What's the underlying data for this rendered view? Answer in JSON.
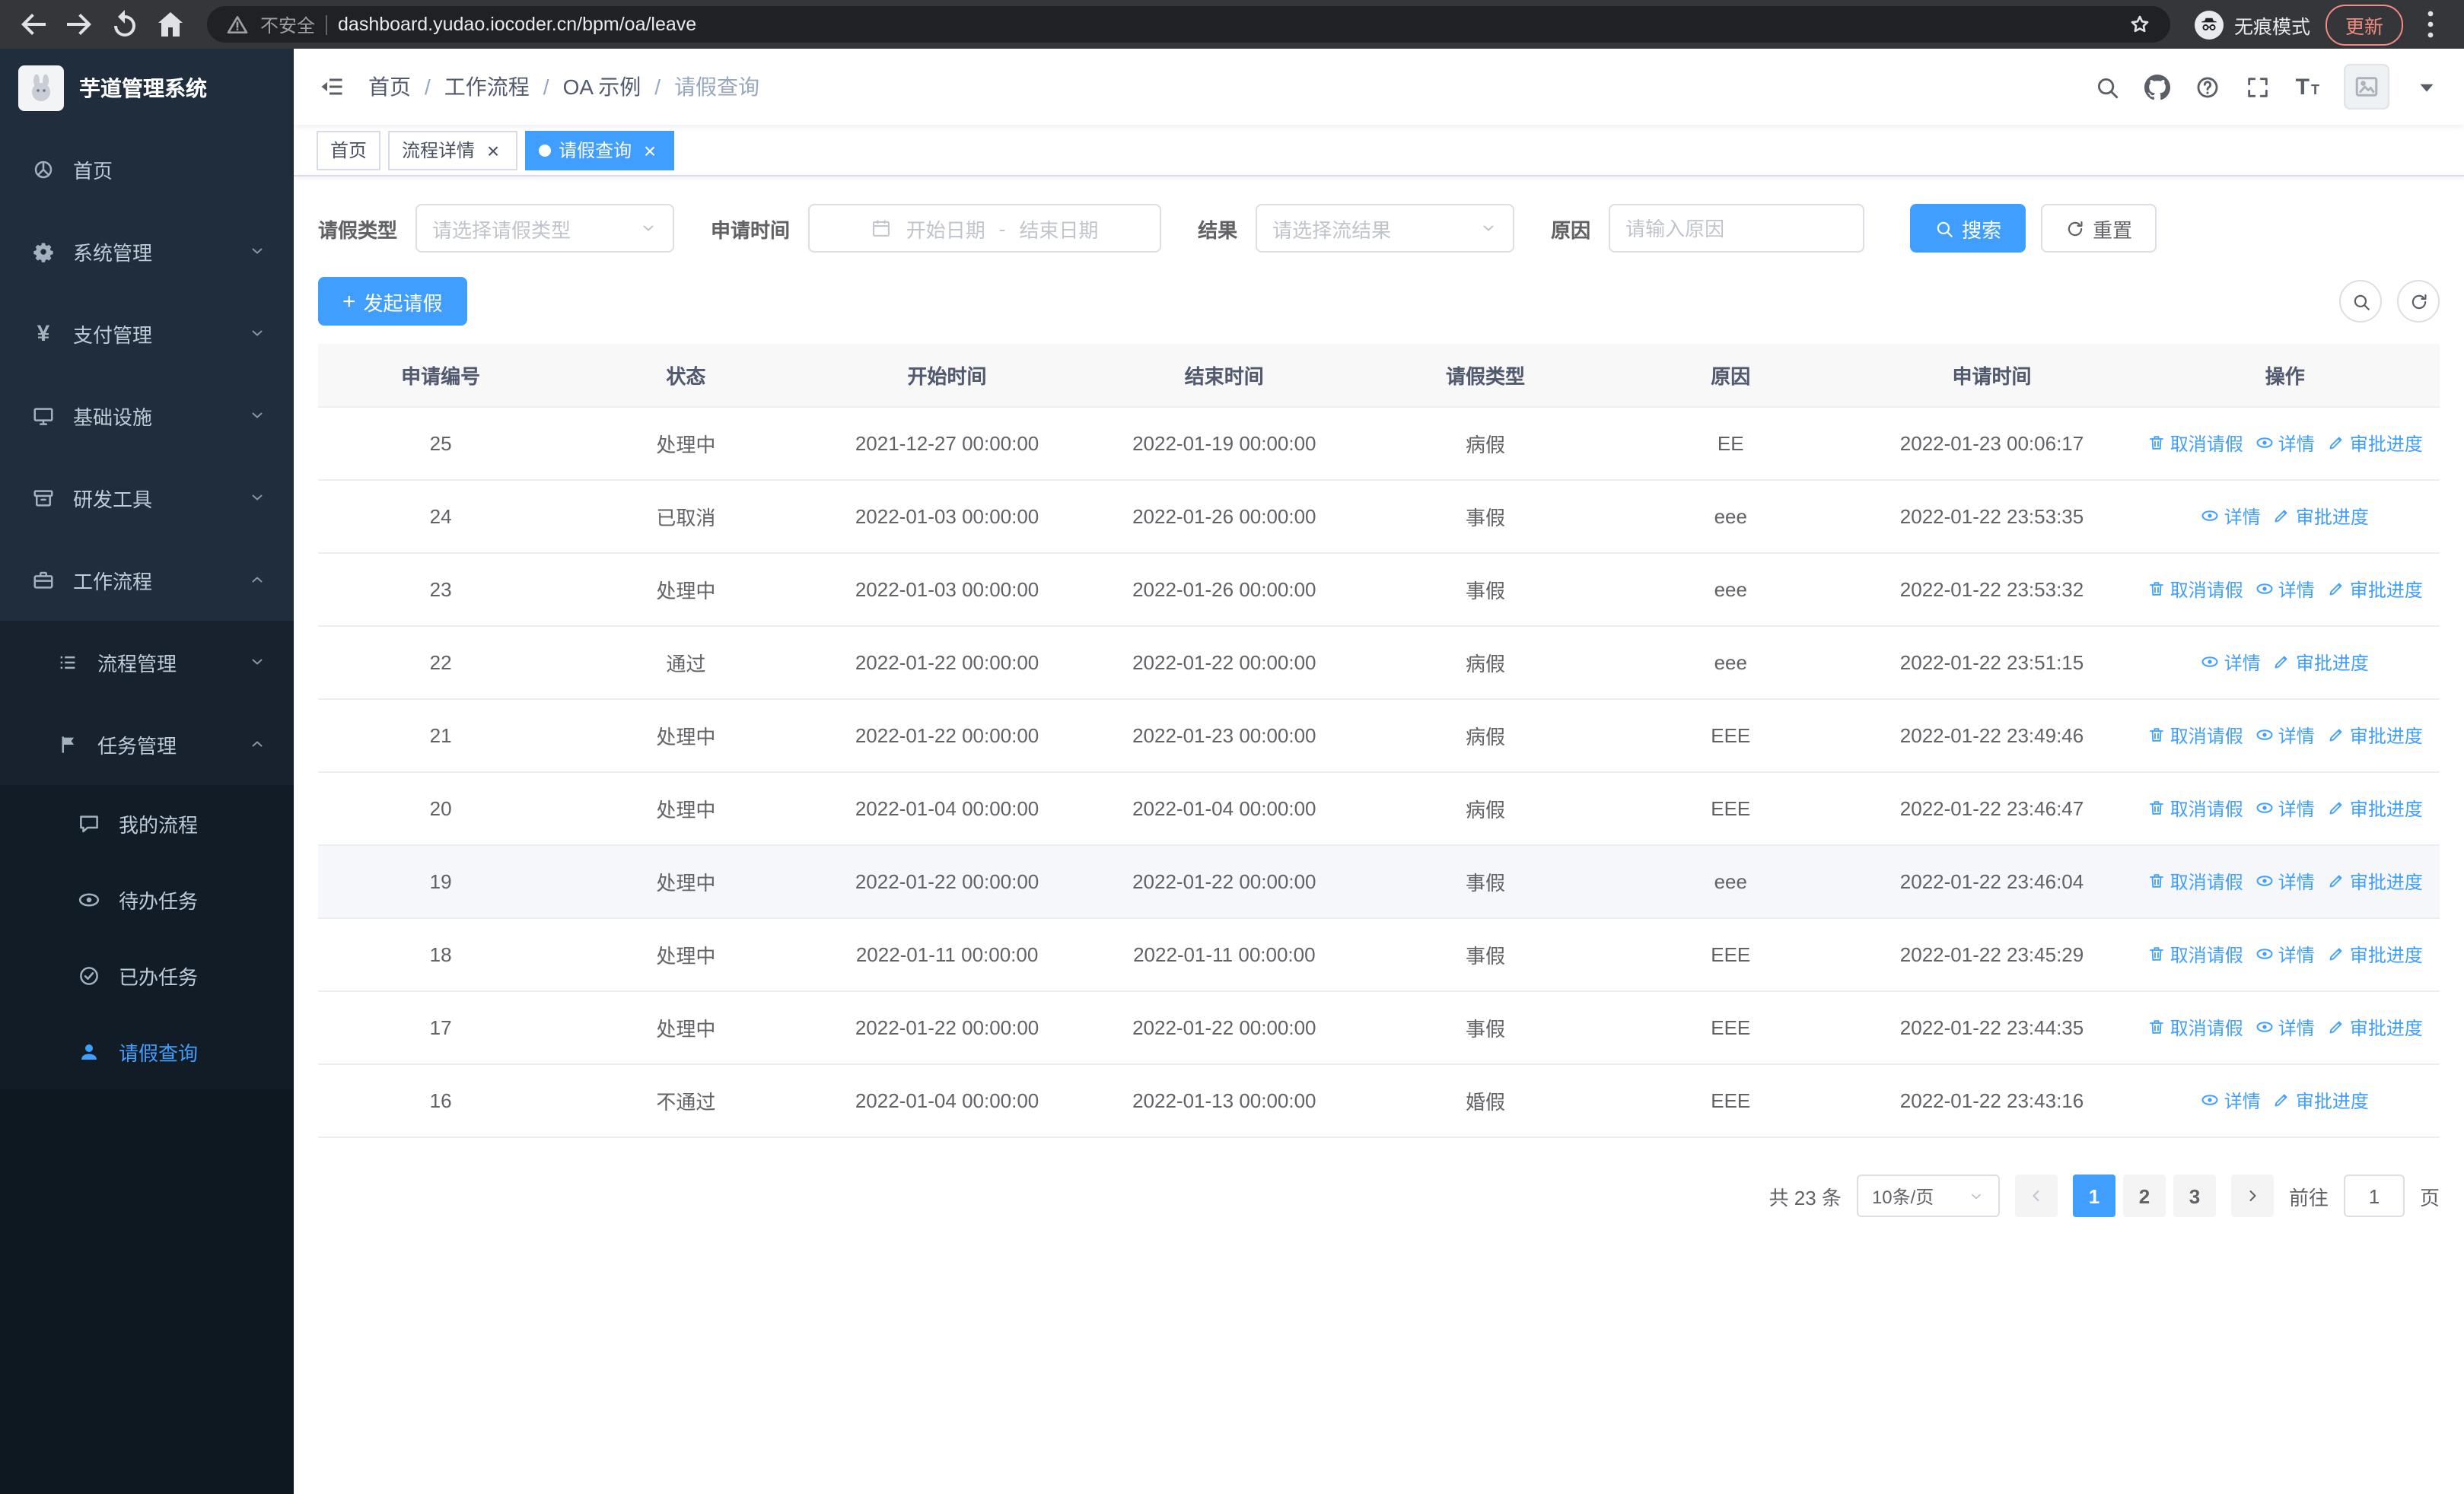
{
  "browser": {
    "security_label": "不安全",
    "url": "dashboard.yudao.iocoder.cn/bpm/oa/leave",
    "incognito_label": "无痕模式",
    "update_label": "更新"
  },
  "sidebar": {
    "logo_title": "芋道管理系统",
    "items": [
      {
        "label": "首页",
        "icon": "dashboard-icon",
        "depth": 0
      },
      {
        "label": "系统管理",
        "icon": "gear-icon",
        "depth": 0,
        "arrow": "down"
      },
      {
        "label": "支付管理",
        "icon": "payment-icon",
        "depth": 0,
        "arrow": "down"
      },
      {
        "label": "基础设施",
        "icon": "infrastructure-icon",
        "depth": 0,
        "arrow": "down"
      },
      {
        "label": "研发工具",
        "icon": "devtools-icon",
        "depth": 0,
        "arrow": "down"
      },
      {
        "label": "工作流程",
        "icon": "workflow-icon",
        "depth": 0,
        "arrow": "up"
      },
      {
        "label": "流程管理",
        "icon": "process-icon",
        "depth": 1,
        "arrow": "down"
      },
      {
        "label": "任务管理",
        "icon": "task-icon",
        "depth": 1,
        "arrow": "up"
      },
      {
        "label": "我的流程",
        "icon": "my-process-icon",
        "depth": 2
      },
      {
        "label": "待办任务",
        "icon": "todo-tasks-icon",
        "depth": 2
      },
      {
        "label": "已办任务",
        "icon": "done-tasks-icon",
        "depth": 2
      },
      {
        "label": "请假查询",
        "icon": "leave-query-icon",
        "depth": 2,
        "active": true
      }
    ]
  },
  "header": {
    "breadcrumb": [
      "首页",
      "工作流程",
      "OA 示例",
      "请假查询"
    ]
  },
  "tabs": [
    {
      "label": "首页"
    },
    {
      "label": "流程详情",
      "closable": true
    },
    {
      "label": "请假查询",
      "closable": true,
      "active": true
    }
  ],
  "filters": {
    "leave_type_label": "请假类型",
    "leave_type_placeholder": "请选择请假类型",
    "apply_time_label": "申请时间",
    "start_date_placeholder": "开始日期",
    "date_separator": "-",
    "end_date_placeholder": "结束日期",
    "result_label": "结果",
    "result_placeholder": "请选择流结果",
    "reason_label": "原因",
    "reason_placeholder": "请输入原因",
    "search_button": "搜索",
    "reset_button": "重置"
  },
  "toolbar": {
    "create_button": "发起请假"
  },
  "table": {
    "columns": [
      "申请编号",
      "状态",
      "开始时间",
      "结束时间",
      "请假类型",
      "原因",
      "申请时间",
      "操作"
    ],
    "action_defs": {
      "cancel": {
        "label": "取消请假",
        "icon": "delete-icon"
      },
      "detail": {
        "label": "详情",
        "icon": "view-icon"
      },
      "progress": {
        "label": "审批进度",
        "icon": "edit-icon"
      }
    },
    "rows": [
      {
        "id": "25",
        "status": "处理中",
        "start": "2021-12-27 00:00:00",
        "end": "2022-01-19 00:00:00",
        "type": "病假",
        "reason": "EE",
        "apply_time": "2022-01-23 00:06:17",
        "actions": [
          "cancel",
          "detail",
          "progress"
        ]
      },
      {
        "id": "24",
        "status": "已取消",
        "start": "2022-01-03 00:00:00",
        "end": "2022-01-26 00:00:00",
        "type": "事假",
        "reason": "eee",
        "apply_time": "2022-01-22 23:53:35",
        "actions": [
          "detail",
          "progress"
        ]
      },
      {
        "id": "23",
        "status": "处理中",
        "start": "2022-01-03 00:00:00",
        "end": "2022-01-26 00:00:00",
        "type": "事假",
        "reason": "eee",
        "apply_time": "2022-01-22 23:53:32",
        "actions": [
          "cancel",
          "detail",
          "progress"
        ]
      },
      {
        "id": "22",
        "status": "通过",
        "start": "2022-01-22 00:00:00",
        "end": "2022-01-22 00:00:00",
        "type": "病假",
        "reason": "eee",
        "apply_time": "2022-01-22 23:51:15",
        "actions": [
          "detail",
          "progress"
        ]
      },
      {
        "id": "21",
        "status": "处理中",
        "start": "2022-01-22 00:00:00",
        "end": "2022-01-23 00:00:00",
        "type": "病假",
        "reason": "EEE",
        "apply_time": "2022-01-22 23:49:46",
        "actions": [
          "cancel",
          "detail",
          "progress"
        ]
      },
      {
        "id": "20",
        "status": "处理中",
        "start": "2022-01-04 00:00:00",
        "end": "2022-01-04 00:00:00",
        "type": "病假",
        "reason": "EEE",
        "apply_time": "2022-01-22 23:46:47",
        "actions": [
          "cancel",
          "detail",
          "progress"
        ]
      },
      {
        "id": "19",
        "status": "处理中",
        "start": "2022-01-22 00:00:00",
        "end": "2022-01-22 00:00:00",
        "type": "事假",
        "reason": "eee",
        "apply_time": "2022-01-22 23:46:04",
        "actions": [
          "cancel",
          "detail",
          "progress"
        ],
        "highlight": true
      },
      {
        "id": "18",
        "status": "处理中",
        "start": "2022-01-11 00:00:00",
        "end": "2022-01-11 00:00:00",
        "type": "事假",
        "reason": "EEE",
        "apply_time": "2022-01-22 23:45:29",
        "actions": [
          "cancel",
          "detail",
          "progress"
        ]
      },
      {
        "id": "17",
        "status": "处理中",
        "start": "2022-01-22 00:00:00",
        "end": "2022-01-22 00:00:00",
        "type": "事假",
        "reason": "EEE",
        "apply_time": "2022-01-22 23:44:35",
        "actions": [
          "cancel",
          "detail",
          "progress"
        ]
      },
      {
        "id": "16",
        "status": "不通过",
        "start": "2022-01-04 00:00:00",
        "end": "2022-01-13 00:00:00",
        "type": "婚假",
        "reason": "EEE",
        "apply_time": "2022-01-22 23:43:16",
        "actions": [
          "detail",
          "progress"
        ]
      }
    ]
  },
  "pagination": {
    "total_label": "共 23 条",
    "page_size_label": "10条/页",
    "pages": [
      "1",
      "2",
      "3"
    ],
    "active_page": "1",
    "goto_label": "前往",
    "goto_value": "1",
    "goto_suffix": "页"
  },
  "colors": {
    "accent": "#409eff",
    "sidebar_bg": "#1f2d3c",
    "update_red": "#f28b82"
  }
}
